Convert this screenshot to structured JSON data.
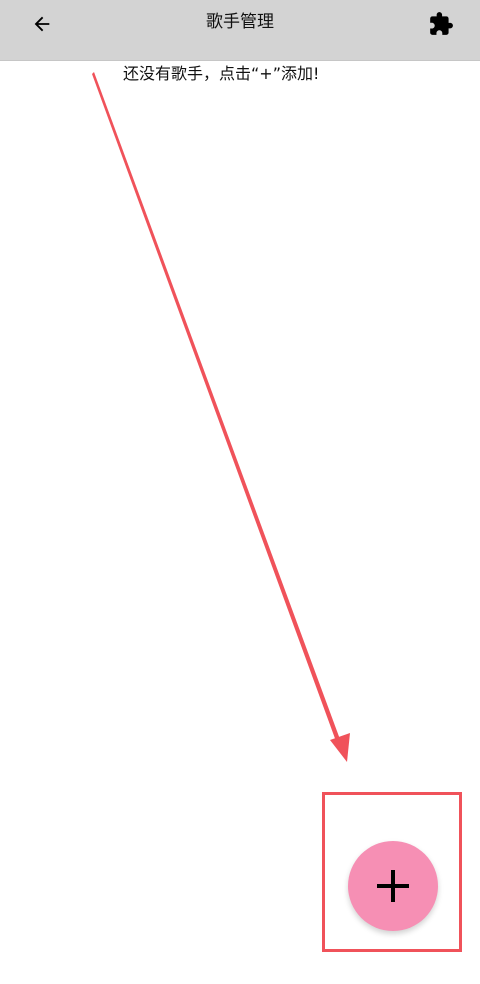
{
  "header": {
    "title": "歌手管理",
    "back_icon": "arrow-left-icon",
    "action_icon": "puzzle-icon"
  },
  "main": {
    "empty_hint": "还没有歌手，点击“+”添加!"
  },
  "fab": {
    "icon": "plus-icon",
    "color": "#f68fb4"
  },
  "annotation": {
    "color": "#f0525a"
  }
}
